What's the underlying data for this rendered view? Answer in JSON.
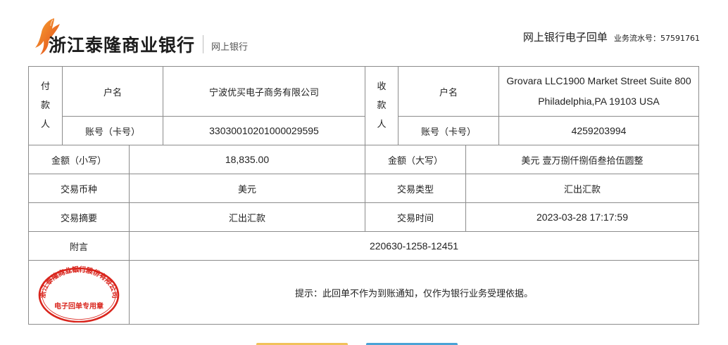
{
  "header": {
    "bank_name": "浙江泰隆商业银行",
    "bank_sub": "网上银行",
    "receipt_title": "网上银行电子回单",
    "serial_label": "业务流水号：",
    "serial_number": "57591761"
  },
  "payer": {
    "group_label": [
      "付",
      "款",
      "人"
    ],
    "name_label": "户名",
    "name_value": "宁波优买电子商务有限公司",
    "account_label": "账号（卡号）",
    "account_value": "33030010201000029595"
  },
  "payee": {
    "group_label": [
      "收",
      "款",
      "人"
    ],
    "name_label": "户名",
    "name_value_line1": "Grovara LLC1900 Market Street Suite 800",
    "name_value_line2": "Philadelphia,PA 19103 USA",
    "account_label": "账号（卡号）",
    "account_value": "4259203994"
  },
  "amount": {
    "small_label": "金额（小写）",
    "small_value": "18,835.00",
    "big_label": "金额（大写）",
    "big_value": "美元 壹万捌仟捌佰叁拾伍圆整"
  },
  "transaction": {
    "currency_label": "交易币种",
    "currency_value": "美元",
    "type_label": "交易类型",
    "type_value": "汇出汇款",
    "summary_label": "交易摘要",
    "summary_value": "汇出汇款",
    "time_label": "交易时间",
    "time_value": "2023-03-28 17:17:59"
  },
  "remark": {
    "label": "附言",
    "value": "220630-1258-12451"
  },
  "stamp": {
    "ring_text": "浙江泰隆商业银行股份有限公司",
    "center_text": "电子回单专用章",
    "color": "#d9251d"
  },
  "notice": "提示：此回单不作为到账通知，仅作为银行业务受理依据。",
  "colors": {
    "logo_orange": "#f08a1c",
    "logo_red": "#e0401a",
    "border": "#8c8c8c",
    "btn_yellow": "#f1c25a",
    "btn_blue": "#4aa3d6"
  }
}
